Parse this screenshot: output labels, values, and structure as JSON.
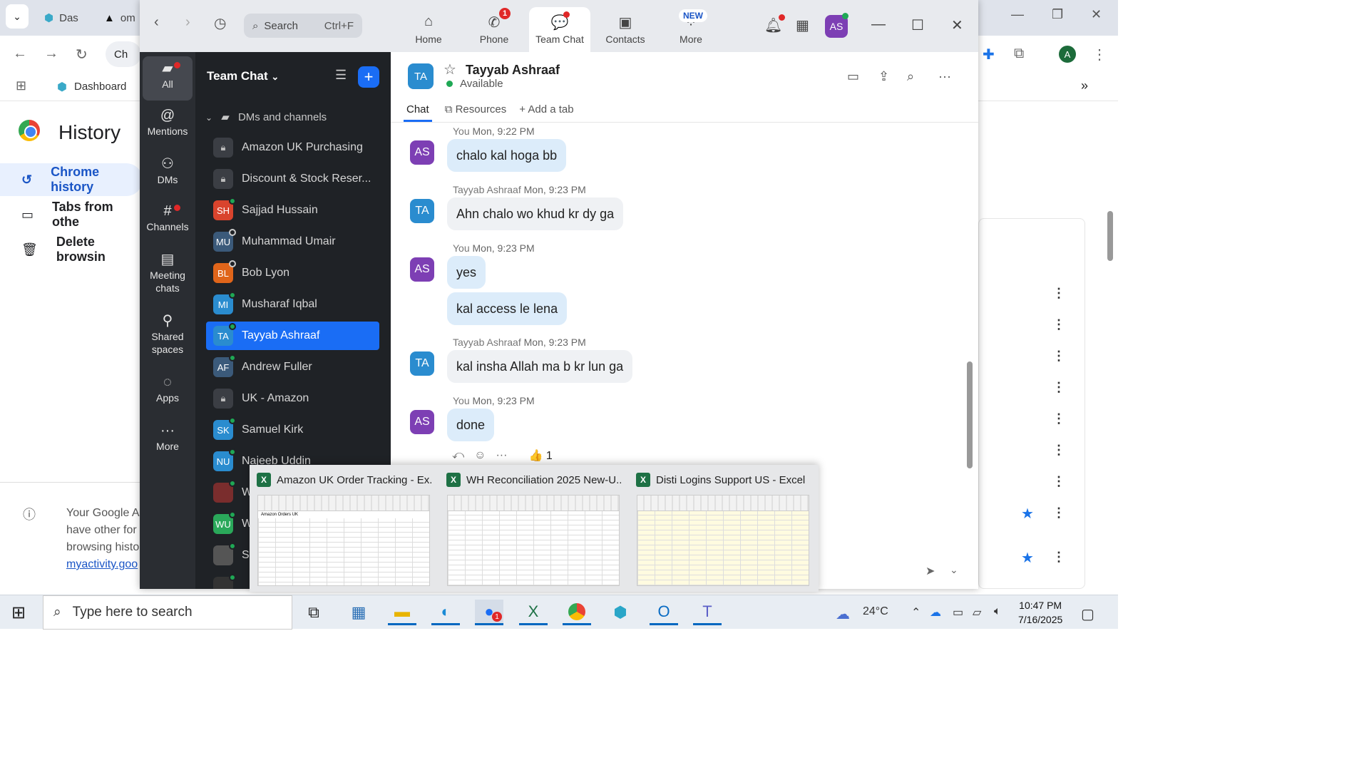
{
  "chrome": {
    "tabs": [
      {
        "label": "Das",
        "icon": "dashboard-icon"
      },
      {
        "label": "om",
        "icon": "app-icon"
      }
    ],
    "bookmark": "Dashboard",
    "address_prefix": "Ch",
    "history_title": "History",
    "nav": [
      {
        "label": "Chrome history",
        "icon": "history-icon",
        "active": true
      },
      {
        "label": "Tabs from othe",
        "icon": "devices-icon",
        "active": false
      },
      {
        "label": "Delete browsin",
        "icon": "trash-icon",
        "active": false
      }
    ],
    "info_text": "Your Google A have other for browsing histo",
    "info_link": "myactivity.goo"
  },
  "zoom": {
    "search_placeholder": "Search",
    "search_shortcut": "Ctrl+F",
    "top_tabs": [
      {
        "label": "Home",
        "icon": "home-icon"
      },
      {
        "label": "Phone",
        "icon": "phone-icon",
        "badge": "1"
      },
      {
        "label": "Team Chat",
        "icon": "chat-icon",
        "active": true
      },
      {
        "label": "Contacts",
        "icon": "contacts-icon"
      },
      {
        "label": "More",
        "icon": "more-icon",
        "tag": "NEW"
      }
    ],
    "user_initials": "AS",
    "rail": [
      {
        "label": "All",
        "icon": "chat-bubble-icon",
        "active": true
      },
      {
        "label": "Mentions",
        "icon": "at-icon"
      },
      {
        "label": "DMs",
        "icon": "people-icon"
      },
      {
        "label": "Channels",
        "icon": "hash-icon"
      },
      {
        "label": "Meeting chats",
        "icon": "calendar-icon"
      },
      {
        "label": "Shared spaces",
        "icon": "share-icon"
      },
      {
        "label": "Apps",
        "icon": "apps-icon"
      },
      {
        "label": "More",
        "icon": "ellipsis-icon"
      }
    ],
    "list_title": "Team Chat",
    "section_label": "DMs and channels",
    "conversations": [
      {
        "name": "Amazon UK Purchasing",
        "type": "channel"
      },
      {
        "name": "Discount & Stock Reser...",
        "type": "channel"
      },
      {
        "name": "Sajjad Hussain",
        "initials": "SH",
        "color": "#d9442d",
        "status": "online"
      },
      {
        "name": "Muhammad Umair",
        "initials": "MU",
        "color": "#3b5a7a",
        "status": "away"
      },
      {
        "name": "Bob Lyon",
        "initials": "BL",
        "color": "#e0651a",
        "status": "away"
      },
      {
        "name": "Musharaf Iqbal",
        "initials": "MI",
        "color": "#2a8ccf",
        "status": "online"
      },
      {
        "name": "Tayyab Ashraaf",
        "initials": "TA",
        "color": "#2a8ccf",
        "status": "online",
        "active": true
      },
      {
        "name": "Andrew Fuller",
        "initials": "AF",
        "color": "#3b5a7a",
        "status": "online"
      },
      {
        "name": "UK - Amazon",
        "type": "channel"
      },
      {
        "name": "Samuel Kirk",
        "initials": "SK",
        "color": "#2a8ccf",
        "status": "online"
      },
      {
        "name": "Najeeb Uddin",
        "initials": "NU",
        "color": "#2a8ccf",
        "status": "online"
      },
      {
        "name": "W",
        "initials": "",
        "color": "#7a2d2d",
        "status": "online"
      },
      {
        "name": "W",
        "initials": "WU",
        "color": "#2aa85a",
        "status": "online"
      },
      {
        "name": "S",
        "initials": "",
        "color": "#555",
        "status": "online"
      },
      {
        "name": "",
        "initials": "",
        "color": "#333",
        "status": "online"
      }
    ],
    "chat": {
      "contact_initials": "TA",
      "contact_name": "Tayyab Ashraaf",
      "contact_status": "Available",
      "tabs": [
        "Chat",
        "Resources",
        "Add a tab"
      ],
      "messages": [
        {
          "sender": "You",
          "time": "Mon, 9:22 PM",
          "initials": "AS",
          "own": true,
          "texts": [
            "chalo kal hoga bb"
          ]
        },
        {
          "sender": "Tayyab Ashraaf",
          "time": "Mon, 9:23 PM",
          "initials": "TA",
          "own": false,
          "texts": [
            "Ahn chalo wo khud kr dy ga"
          ]
        },
        {
          "sender": "You",
          "time": "Mon, 9:23 PM",
          "initials": "AS",
          "own": true,
          "texts": [
            "yes",
            "kal access le lena"
          ]
        },
        {
          "sender": "Tayyab Ashraaf",
          "time": "Mon, 9:23 PM",
          "initials": "TA",
          "own": false,
          "texts": [
            "kal insha Allah ma b kr lun ga"
          ]
        },
        {
          "sender": "You",
          "time": "Mon, 9:23 PM",
          "initials": "AS",
          "own": true,
          "texts": [
            "done"
          ]
        }
      ],
      "reaction": {
        "emoji": "👍",
        "count": "1"
      }
    }
  },
  "preview": [
    {
      "title": "Amazon UK Order Tracking - Ex...",
      "sheet_heading": "Amazon Orders UK"
    },
    {
      "title": "WH Reconciliation 2025 New-U..."
    },
    {
      "title": "Disti Logins Support US - Excel"
    }
  ],
  "taskbar": {
    "search_placeholder": "Type here to search",
    "weather": "24°C",
    "time": "10:47 PM",
    "date": "7/16/2025",
    "zoom_badge": "1"
  }
}
